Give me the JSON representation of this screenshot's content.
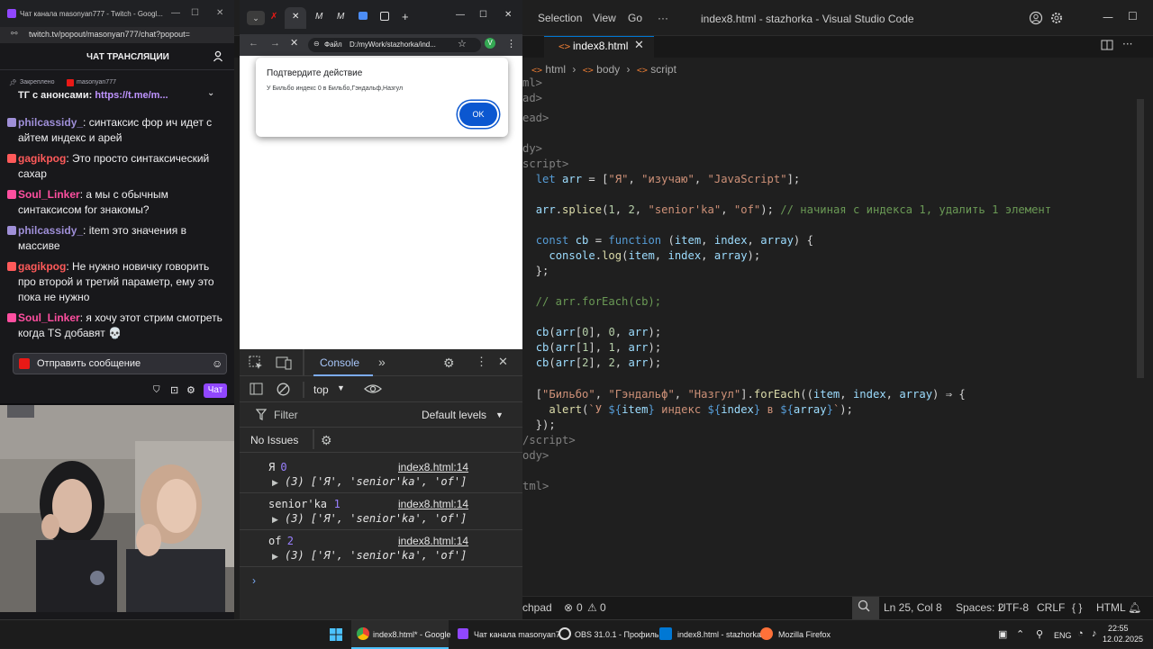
{
  "vscode": {
    "menu": [
      "Selection",
      "View",
      "Go",
      "···"
    ],
    "window_title": "index8.html - stazhorka - Visual Studio Code",
    "tab_label": "index8.html",
    "breadcrumb": [
      "html",
      "body",
      "script"
    ],
    "code_lines": [
      {
        "text": "ml>",
        "kind": "tag"
      },
      {
        "text": "ad>",
        "kind": "tag"
      },
      {
        "text": "ead>",
        "kind": "tag"
      },
      {
        "text": "",
        "kind": "plain"
      },
      {
        "text": "dy>",
        "kind": "tag"
      },
      {
        "text": "script>",
        "kind": "tag"
      },
      {
        "text": "  let arr = [\"Я\", \"изучаю\", \"JavaScript\"];",
        "kind": "code"
      },
      {
        "text": "",
        "kind": "plain"
      },
      {
        "text": "  arr.splice(1, 2, \"senior'ka\", \"of\"); // начиная с индекса 1, удалить 1 элемент",
        "kind": "code"
      },
      {
        "text": "",
        "kind": "plain"
      },
      {
        "text": "  const cb = function (item, index, array) {",
        "kind": "code"
      },
      {
        "text": "    console.log(item, index, array);",
        "kind": "code"
      },
      {
        "text": "  };",
        "kind": "code"
      },
      {
        "text": "",
        "kind": "plain"
      },
      {
        "text": "  // arr.forEach(cb);",
        "kind": "comment"
      },
      {
        "text": "",
        "kind": "plain"
      },
      {
        "text": "  cb(arr[0], 0, arr);",
        "kind": "code"
      },
      {
        "text": "  cb(arr[1], 1, arr);",
        "kind": "code"
      },
      {
        "text": "  cb(arr[2], 2, arr);",
        "kind": "code"
      },
      {
        "text": "",
        "kind": "plain"
      },
      {
        "text": "  [\"Бильбо\", \"Гэндальф\", \"Назгул\"].forEach((item, index, array) ⇒ {",
        "kind": "code"
      },
      {
        "text": "    alert(`У ${item} индекс ${index} в ${array}`);",
        "kind": "code"
      },
      {
        "text": "  });",
        "kind": "code"
      },
      {
        "text": "/script>",
        "kind": "tag"
      },
      {
        "text": "ody>",
        "kind": "tag"
      },
      {
        "text": "",
        "kind": "plain"
      },
      {
        "text": "tml>",
        "kind": "tag"
      }
    ],
    "status": {
      "left_label": "chpad",
      "errors": "0",
      "warnings": "0",
      "position": "Ln 25, Col 8",
      "spaces": "Spaces: 2",
      "encoding": "UTF-8",
      "eol": "CRLF",
      "language": "HTML"
    }
  },
  "twitch": {
    "window_title": "Чат канала masonyan777 - Twitch - Googl...",
    "url": "twitch.tv/popout/masonyan777/chat?popout=",
    "header": "ЧАТ ТРАНСЛЯЦИИ",
    "pinned_label": "Закреплено",
    "pinned_by": "masonyan777",
    "pinned_text_prefix": "ТГ с анонсами: ",
    "pinned_link": "https://t.me/m...",
    "messages": [
      {
        "user": "philcassidy_",
        "color": "#9f8fd8",
        "text": ": синтаксис фор ич идет с айтем индекс и арей"
      },
      {
        "user": "gagikpog",
        "color": "#ff5a5a",
        "text": ": Это просто синтаксический сахар"
      },
      {
        "user": "Soul_Linker",
        "color": "#ff4fa0",
        "text": ": а мы с обычным синтаксисом for знакомы?"
      },
      {
        "user": "philcassidy_",
        "color": "#9f8fd8",
        "text": ": item это значения в массиве"
      },
      {
        "user": "gagikpog",
        "color": "#ff5a5a",
        "text": ": Не нужно новичку говорить про второй и третий параметр, ему это пока не нужно"
      },
      {
        "user": "Soul_Linker",
        "color": "#ff4fa0",
        "text": ": я хочу этот стрим смотреть когда TS добавят 💀"
      }
    ],
    "input_placeholder": "Отправить сообщение",
    "chat_button": "Чат"
  },
  "chrome": {
    "omnibox_chip": "Файл",
    "url": "D:/myWork/stazhorka/ind...",
    "dialog": {
      "title": "Подтвердите действие",
      "message": "У Бильбо индекс 0 в Бильбо,Гэндальф,Назгул",
      "ok": "OK"
    },
    "devtools": {
      "console_tab": "Console",
      "context": "top",
      "filter_placeholder": "Filter",
      "levels": "Default levels",
      "issues": "No Issues",
      "logs": [
        {
          "label": "Я",
          "index": "0",
          "array": "(3) ['Я', 'senior'ka', 'of']",
          "source": "index8.html:14"
        },
        {
          "label": "senior'ka",
          "index": "1",
          "array": "(3) ['Я', 'senior'ka', 'of']",
          "source": "index8.html:14"
        },
        {
          "label": "of",
          "index": "2",
          "array": "(3) ['Я', 'senior'ka', 'of']",
          "source": "index8.html:14"
        }
      ],
      "prompt": "›"
    }
  },
  "taskbar": {
    "items": [
      {
        "label": "index8.html* - Google"
      },
      {
        "label": "Чат канала masonyan7"
      },
      {
        "label": "OBS 31.0.1 - Профиль: 8"
      },
      {
        "label": "index8.html - stazhorka"
      },
      {
        "label": "Mozilla Firefox"
      }
    ],
    "lang": "ENG",
    "time": "22:55",
    "date": "12.02.2025"
  },
  "colors": {
    "accent_blue": "#0078d4",
    "twitch_purple": "#9147ff",
    "taskbar_highlight": "#4cc2ff"
  }
}
